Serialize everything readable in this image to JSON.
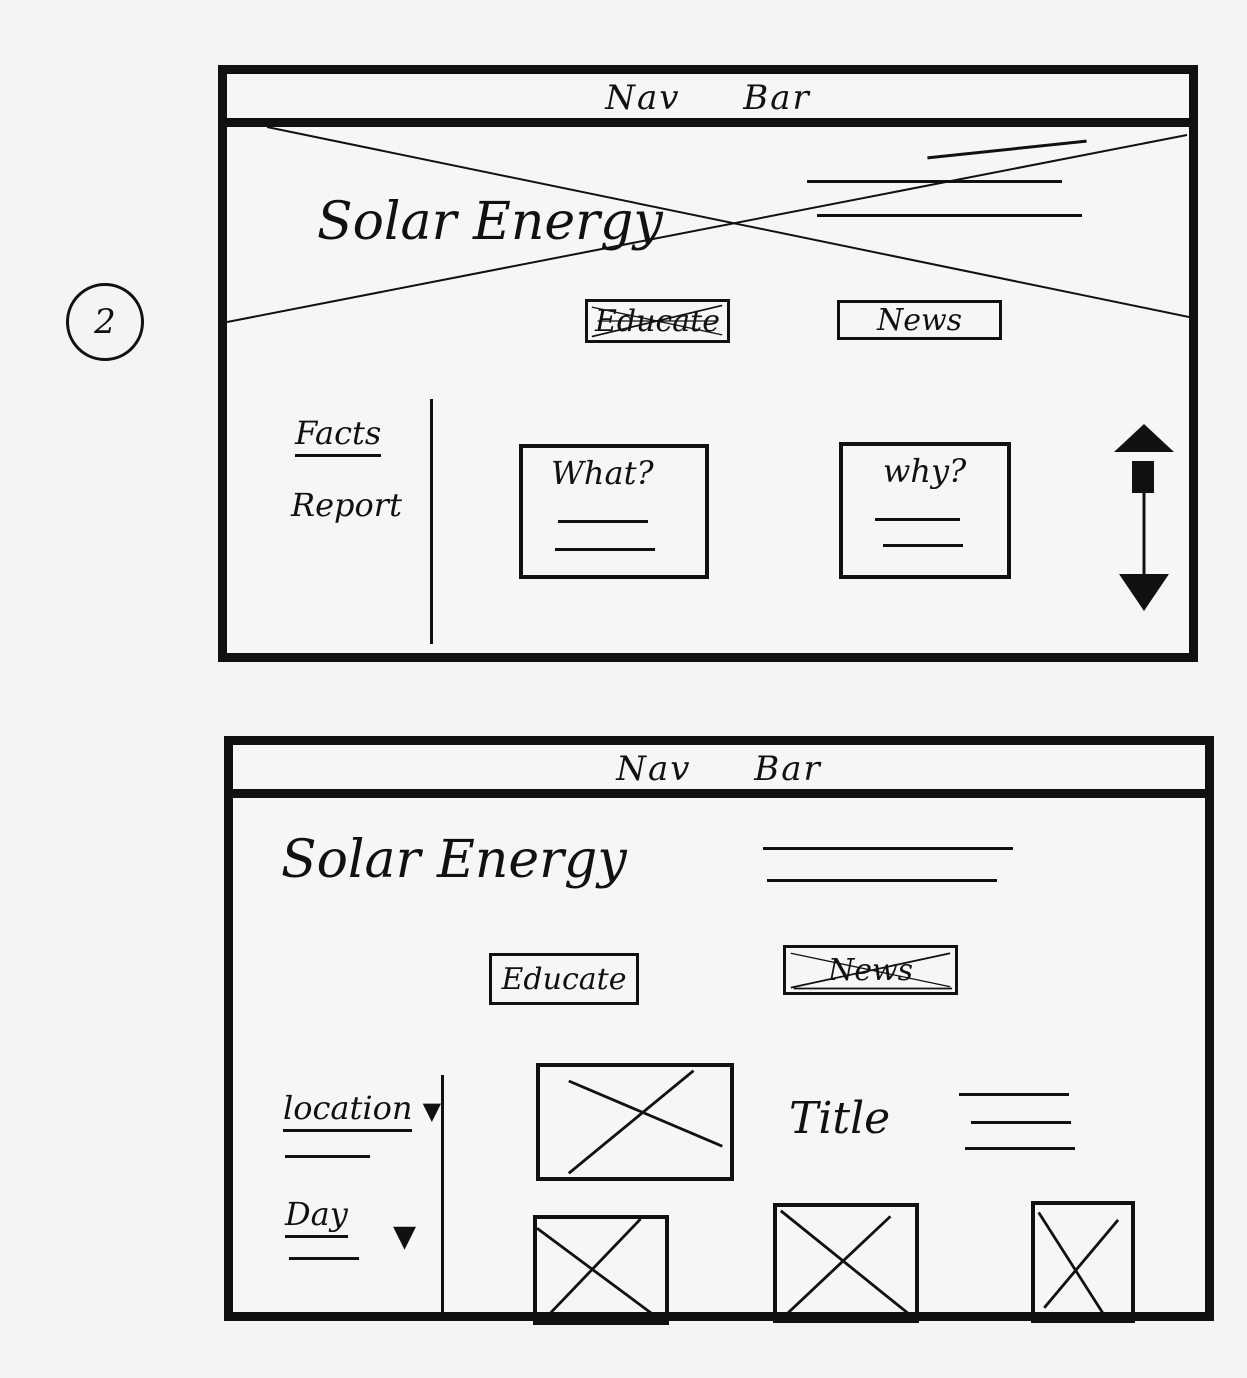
{
  "page_number": "2",
  "wireframe_1": {
    "navbar_label": "Nav Bar",
    "hero_title": "Solar Energy",
    "buttons": {
      "educate": "Educate",
      "news": "News"
    },
    "sidebar": {
      "facts": "Facts",
      "report": "Report"
    },
    "cards": {
      "what": "What?",
      "why": "why?"
    }
  },
  "wireframe_2": {
    "navbar_label": "Nav Bar",
    "hero_title": "Solar Energy",
    "buttons": {
      "educate": "Educate",
      "news": "News"
    },
    "sidebar": {
      "location": "location",
      "day": "Day"
    },
    "feature_title": "Title"
  }
}
